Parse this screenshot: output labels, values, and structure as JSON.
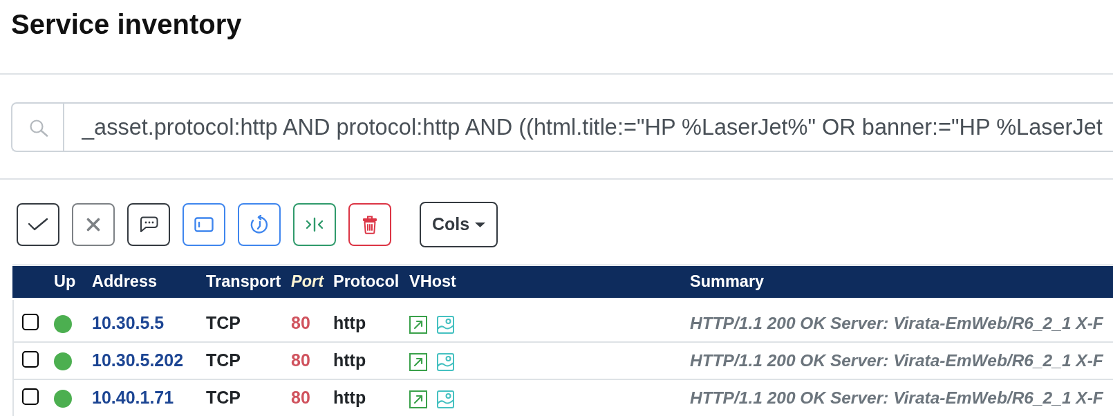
{
  "page": {
    "title": "Service inventory"
  },
  "search": {
    "value": "_asset.protocol:http AND protocol:http AND ((html.title:=\"HP %LaserJet%\" OR banner:=\"HP %LaserJet"
  },
  "toolbar": {
    "columns_menu": {
      "label": "Cols"
    }
  },
  "table": {
    "columns": [
      {
        "label": "Up",
        "sorted": false
      },
      {
        "label": "Address",
        "sorted": false
      },
      {
        "label": "Transport",
        "sorted": false
      },
      {
        "label": "Port",
        "sorted": true
      },
      {
        "label": "Protocol",
        "sorted": false
      },
      {
        "label": "VHost",
        "sorted": false
      },
      {
        "label": "Summary",
        "sorted": false
      }
    ],
    "rows": [
      {
        "checked": false,
        "up": true,
        "address": "10.30.5.5",
        "transport": "TCP",
        "port": "80",
        "protocol": "http",
        "summary": "HTTP/1.1 200 OK Server: Virata-EmWeb/R6_2_1 X-F"
      },
      {
        "checked": false,
        "up": true,
        "address": "10.30.5.202",
        "transport": "TCP",
        "port": "80",
        "protocol": "http",
        "summary": "HTTP/1.1 200 OK Server: Virata-EmWeb/R6_2_1 X-F"
      },
      {
        "checked": false,
        "up": true,
        "address": "10.40.1.71",
        "transport": "TCP",
        "port": "80",
        "protocol": "http",
        "summary": "HTTP/1.1 200 OK Server: Virata-EmWeb/R6_2_1 X-F"
      }
    ]
  }
}
